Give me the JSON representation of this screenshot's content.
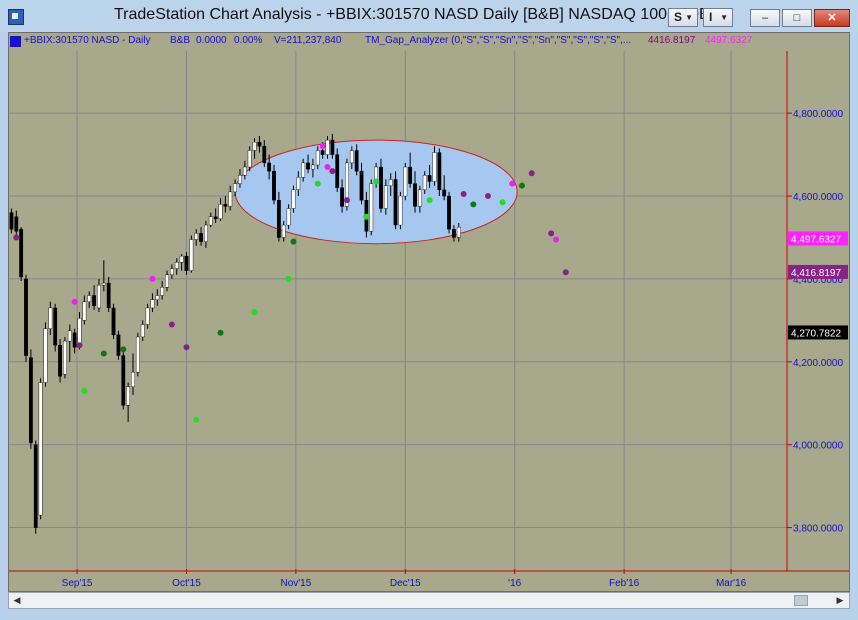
{
  "window": {
    "title": "TradeStation Chart Analysis - +BBIX:301570 NASD Daily [B&B] NASDAQ 100 INDE",
    "btn_s": "S",
    "btn_i": "I",
    "min_glyph": "–",
    "max_glyph": "□",
    "close_glyph": "✕"
  },
  "status": {
    "symbol": "+BBIX:301570 NASD - Daily",
    "bb": "B&B",
    "val1": "0.0000",
    "val2": "0.00%",
    "volume": "V=211,237,840",
    "indicator": "TM_Gap_Analyzer (0,\"S\",\"S\",\"Sn\",\"S\",\"Sn\",\"S\",\"S\",\"S\",\"S\",...",
    "v1": "4416.8197",
    "v2": "4497.6327"
  },
  "colors": {
    "chart_bg": "#a7a88c",
    "grid": "#888888",
    "axis_text": "#1111cc",
    "ellipse_fill": "#a6c8f0",
    "ellipse_stroke": "#cc2222",
    "magenta": "#ee22ee",
    "purple": "#882288",
    "green": "#22dd22",
    "darkgreen": "#117711",
    "status_blue": "#1a10cc",
    "status_purple": "#880088",
    "status_magenta": "#ff22ff"
  },
  "chart_data": {
    "type": "ohlc",
    "symbol": "+BBIX:301570 NASD Daily",
    "ylim": [
      3700,
      4950
    ],
    "y_ticks": [
      "4,800.0000",
      "4,600.0000",
      "4,400.0000",
      "4,200.0000",
      "4,000.0000",
      "3,800.0000"
    ],
    "y_tick_values": [
      4800,
      4600,
      4400,
      4200,
      4000,
      3800
    ],
    "x_ticks": [
      "Sep'15",
      "Oct'15",
      "Nov'15",
      "Dec'15",
      "'16",
      "Feb'16",
      "Mar'16"
    ],
    "x_tick_bars": [
      13.5,
      36,
      58.5,
      81,
      103.5,
      126,
      148
    ],
    "price_labels": [
      {
        "text": "4,497.6327",
        "value": 4497.6327,
        "color": "#ff22ff",
        "textColor": "#ffffff"
      },
      {
        "text": "4,416.8197",
        "value": 4416.8197,
        "color": "#882288",
        "textColor": "#ffffff"
      },
      {
        "text": "4,270.7822",
        "value": 4270.7822,
        "color": "#000000",
        "textColor": "#ffffff"
      }
    ],
    "ellipse": {
      "bar_start": 46,
      "bar_end": 104,
      "price_top": 4735,
      "price_bottom": 4485
    },
    "bars": [
      [
        4560,
        4570,
        4510,
        4520
      ],
      [
        4550,
        4565,
        4505,
        4515
      ],
      [
        4520,
        4525,
        4395,
        4405
      ],
      [
        4400,
        4410,
        4200,
        4215
      ],
      [
        4210,
        4230,
        3990,
        4005
      ],
      [
        4000,
        4010,
        3785,
        3800
      ],
      [
        3830,
        4160,
        3820,
        4150
      ],
      [
        4150,
        4295,
        4140,
        4280
      ],
      [
        4280,
        4345,
        4265,
        4330
      ],
      [
        4330,
        4340,
        4225,
        4240
      ],
      [
        4240,
        4255,
        4150,
        4165
      ],
      [
        4170,
        4260,
        4160,
        4250
      ],
      [
        4250,
        4290,
        4200,
        4275
      ],
      [
        4270,
        4280,
        4220,
        4235
      ],
      [
        4240,
        4320,
        4230,
        4305
      ],
      [
        4300,
        4360,
        4290,
        4345
      ],
      [
        4345,
        4370,
        4330,
        4360
      ],
      [
        4360,
        4385,
        4325,
        4335
      ],
      [
        4330,
        4400,
        4320,
        4385
      ],
      [
        4385,
        4445,
        4370,
        4390
      ],
      [
        4390,
        4405,
        4320,
        4330
      ],
      [
        4330,
        4340,
        4255,
        4265
      ],
      [
        4265,
        4275,
        4205,
        4215
      ],
      [
        4215,
        4225,
        4085,
        4095
      ],
      [
        4095,
        4150,
        4055,
        4140
      ],
      [
        4140,
        4220,
        4120,
        4175
      ],
      [
        4175,
        4270,
        4165,
        4260
      ],
      [
        4260,
        4300,
        4250,
        4290
      ],
      [
        4290,
        4340,
        4280,
        4330
      ],
      [
        4330,
        4365,
        4320,
        4350
      ],
      [
        4350,
        4375,
        4335,
        4360
      ],
      [
        4360,
        4395,
        4350,
        4380
      ],
      [
        4380,
        4420,
        4370,
        4410
      ],
      [
        4410,
        4435,
        4400,
        4425
      ],
      [
        4425,
        4450,
        4410,
        4440
      ],
      [
        4440,
        4460,
        4420,
        4455
      ],
      [
        4455,
        4465,
        4410,
        4420
      ],
      [
        4420,
        4505,
        4415,
        4495
      ],
      [
        4495,
        4520,
        4480,
        4510
      ],
      [
        4510,
        4525,
        4480,
        4490
      ],
      [
        4490,
        4540,
        4475,
        4530
      ],
      [
        4530,
        4560,
        4525,
        4550
      ],
      [
        4550,
        4570,
        4535,
        4545
      ],
      [
        4545,
        4595,
        4540,
        4580
      ],
      [
        4580,
        4600,
        4560,
        4575
      ],
      [
        4575,
        4625,
        4565,
        4610
      ],
      [
        4610,
        4640,
        4600,
        4630
      ],
      [
        4630,
        4665,
        4620,
        4650
      ],
      [
        4650,
        4685,
        4640,
        4670
      ],
      [
        4670,
        4720,
        4660,
        4710
      ],
      [
        4710,
        4740,
        4690,
        4730
      ],
      [
        4730,
        4745,
        4705,
        4720
      ],
      [
        4720,
        4735,
        4670,
        4680
      ],
      [
        4680,
        4700,
        4640,
        4660
      ],
      [
        4660,
        4675,
        4580,
        4590
      ],
      [
        4590,
        4610,
        4490,
        4500
      ],
      [
        4500,
        4540,
        4490,
        4530
      ],
      [
        4530,
        4580,
        4520,
        4570
      ],
      [
        4570,
        4625,
        4560,
        4615
      ],
      [
        4615,
        4660,
        4600,
        4645
      ],
      [
        4645,
        4690,
        4635,
        4680
      ],
      [
        4680,
        4700,
        4655,
        4665
      ],
      [
        4665,
        4690,
        4645,
        4675
      ],
      [
        4675,
        4720,
        4665,
        4710
      ],
      [
        4710,
        4730,
        4690,
        4700
      ],
      [
        4700,
        4745,
        4690,
        4735
      ],
      [
        4735,
        4750,
        4690,
        4700
      ],
      [
        4700,
        4715,
        4610,
        4620
      ],
      [
        4620,
        4640,
        4560,
        4575
      ],
      [
        4575,
        4690,
        4565,
        4680
      ],
      [
        4680,
        4720,
        4665,
        4710
      ],
      [
        4710,
        4725,
        4650,
        4660
      ],
      [
        4660,
        4680,
        4580,
        4590
      ],
      [
        4590,
        4610,
        4500,
        4515
      ],
      [
        4515,
        4640,
        4505,
        4630
      ],
      [
        4630,
        4680,
        4620,
        4670
      ],
      [
        4670,
        4690,
        4560,
        4570
      ],
      [
        4570,
        4640,
        4555,
        4625
      ],
      [
        4625,
        4655,
        4600,
        4640
      ],
      [
        4640,
        4660,
        4520,
        4530
      ],
      [
        4530,
        4610,
        4520,
        4600
      ],
      [
        4600,
        4680,
        4590,
        4670
      ],
      [
        4670,
        4705,
        4620,
        4630
      ],
      [
        4630,
        4660,
        4560,
        4575
      ],
      [
        4575,
        4625,
        4560,
        4615
      ],
      [
        4615,
        4660,
        4605,
        4650
      ],
      [
        4650,
        4675,
        4620,
        4635
      ],
      [
        4635,
        4720,
        4625,
        4705
      ],
      [
        4705,
        4715,
        4600,
        4615
      ],
      [
        4615,
        4650,
        4590,
        4600
      ],
      [
        4600,
        4610,
        4510,
        4520
      ],
      [
        4520,
        4530,
        4490,
        4500
      ],
      [
        4500,
        4535,
        4490,
        4525
      ]
    ],
    "dots": [
      [
        1,
        4500,
        "#882288"
      ],
      [
        13,
        4345,
        "#ee22ee"
      ],
      [
        14,
        4240,
        "#882288"
      ],
      [
        15,
        4130,
        "#22dd22"
      ],
      [
        19,
        4220,
        "#117711"
      ],
      [
        23,
        4230,
        "#117711"
      ],
      [
        29,
        4400,
        "#ee22ee"
      ],
      [
        33,
        4290,
        "#882288"
      ],
      [
        36,
        4235,
        "#882288"
      ],
      [
        38,
        4060,
        "#22dd22"
      ],
      [
        43,
        4270,
        "#117711"
      ],
      [
        50,
        4320,
        "#22dd22"
      ],
      [
        57,
        4400,
        "#22dd22"
      ],
      [
        58,
        4490,
        "#117711"
      ],
      [
        63,
        4630,
        "#22dd22"
      ],
      [
        64,
        4720,
        "#ee22ee"
      ],
      [
        65,
        4670,
        "#ee22ee"
      ],
      [
        66,
        4660,
        "#882288"
      ],
      [
        69,
        4590,
        "#882288"
      ],
      [
        73,
        4550,
        "#22dd22"
      ],
      [
        75,
        4635,
        "#22dd22"
      ],
      [
        86,
        4590,
        "#22dd22"
      ],
      [
        93,
        4605,
        "#882288"
      ],
      [
        95,
        4580,
        "#117711"
      ],
      [
        98,
        4600,
        "#882288"
      ],
      [
        101,
        4585,
        "#22dd22"
      ],
      [
        103,
        4630,
        "#ee22ee"
      ],
      [
        105,
        4625,
        "#117711"
      ],
      [
        107,
        4655,
        "#882288"
      ],
      [
        111,
        4510,
        "#882288"
      ],
      [
        112,
        4495,
        "#ee22ee"
      ],
      [
        114,
        4416,
        "#882288"
      ]
    ],
    "bar_count": 160
  }
}
